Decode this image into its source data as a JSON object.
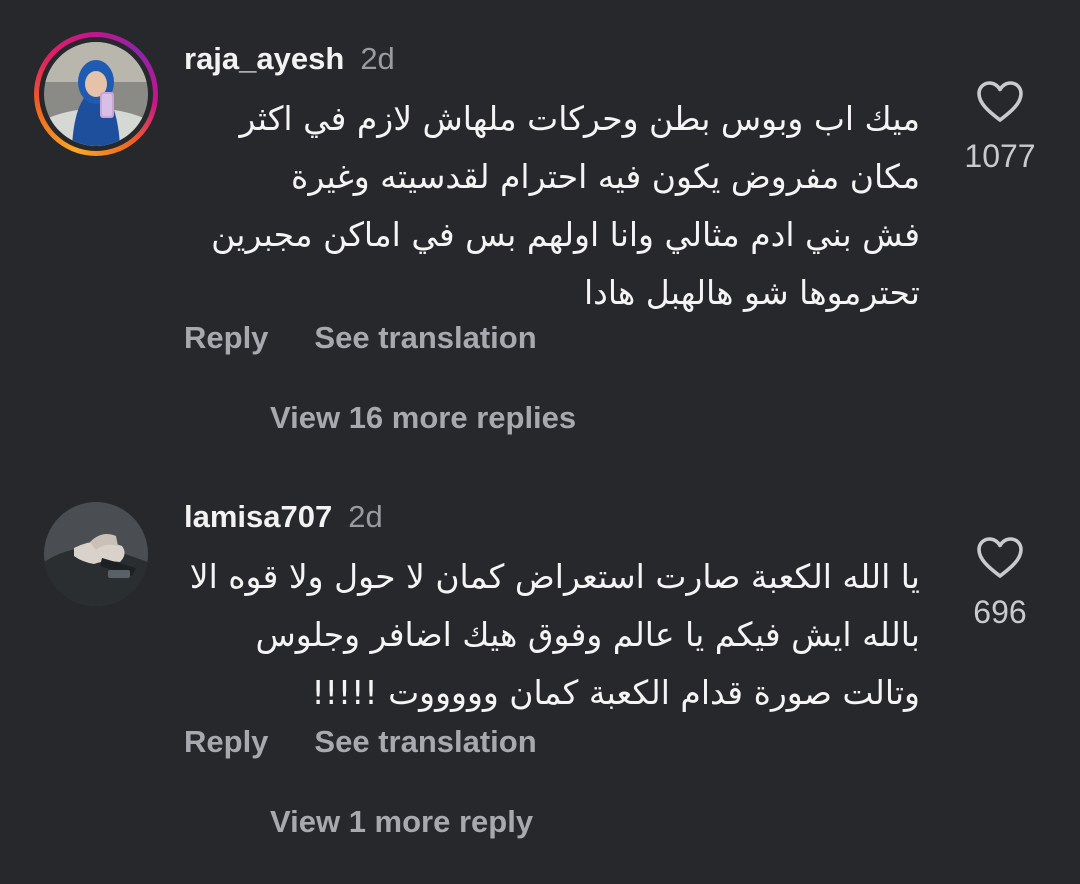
{
  "comments": [
    {
      "username": "raja_ayesh",
      "time": "2d",
      "body_lines": [
        "ميك اب وبوس بطن وحركات ملهاش لازم في اكثر",
        "مكان مفروض يكون فيه احترام لقدسيته وغيرة",
        "فش بني ادم مثالي وانا اولهم بس في اماكن مجبرين",
        "تحترموها شو هالهبل هادا"
      ],
      "likes": "1077",
      "reply_label": "Reply",
      "translate_label": "See translation",
      "view_replies_label": "View 16 more replies",
      "has_story_ring": true
    },
    {
      "username": "lamisa707",
      "time": "2d",
      "body_lines": [
        "يا الله الكعبة صارت استعراض كمان لا حول ولا قوه الا",
        "بالله ايش فيكم يا عالم وفوق هيك اضافر وجلوس",
        "وتالت صورة قدام الكعبة كمان وووووت !!!!!"
      ],
      "likes": "696",
      "reply_label": "Reply",
      "translate_label": "See translation",
      "view_replies_label": "View 1 more reply",
      "has_story_ring": false
    }
  ],
  "icons": {
    "like": "heart-outline-icon"
  },
  "colors": {
    "background": "#27282b",
    "primary_text": "#f2f2f2",
    "secondary_text": "#a8a9ae",
    "story_ring_start": "#f9a825",
    "story_ring_end": "#c8148c"
  }
}
